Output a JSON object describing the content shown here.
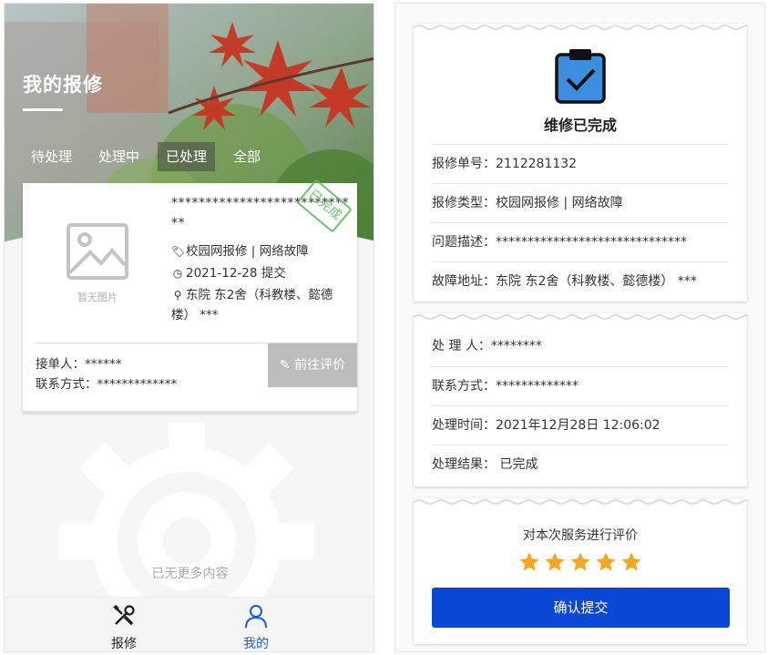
{
  "left_screen": {
    "title": "我的报修",
    "tabs": [
      {
        "label": "待处理"
      },
      {
        "label": "处理中"
      },
      {
        "label": "已处理"
      },
      {
        "label": "全部"
      }
    ],
    "active_tab": "已处理",
    "order": {
      "title": "****************************",
      "stamp": "已完成",
      "no_image_label": "暂无图片",
      "category": "校园网报修 | 网络故障",
      "date": "2021-12-28 提交",
      "address": "东院 东2舍（科教楼、懿德楼） ***",
      "receiver": "接单人：******",
      "contact": "联系方式：*************",
      "rate_button": "前往评价"
    },
    "no_more": "已无更多内容",
    "nav": [
      {
        "label": "报修",
        "icon": "wrench-screwdriver-icon",
        "active": false
      },
      {
        "label": "我的",
        "icon": "user-icon",
        "active": true
      }
    ],
    "colors": {
      "active_nav": "#1a5fd8",
      "stamp": "#5cbd5e"
    }
  },
  "right_screen": {
    "status": "维修已完成",
    "status_icon": "clipboard-check-icon",
    "details": [
      {
        "label": "报修单号：",
        "value": "2112281132"
      },
      {
        "label": "报修类型：",
        "value": "校园网报修 | 网络故障"
      },
      {
        "label": "问题描述：",
        "value": "******************************"
      },
      {
        "label": "故障地址：",
        "value": "东院 东2舍（科教楼、懿德楼） ***"
      }
    ],
    "process": [
      {
        "label": "处 理 人：",
        "value": "********"
      },
      {
        "label": "联系方式：",
        "value": "*************"
      },
      {
        "label": "处理时间：",
        "value": "2021年12月28日 12:06:02"
      },
      {
        "label": "处理结果：",
        "value": " 已完成"
      }
    ],
    "rating": {
      "title": "对本次服务进行评价",
      "stars": 5,
      "max_stars": 5,
      "submit": "确认提交"
    },
    "colors": {
      "primary": "#0a47d4",
      "star": "#f5a623"
    }
  }
}
